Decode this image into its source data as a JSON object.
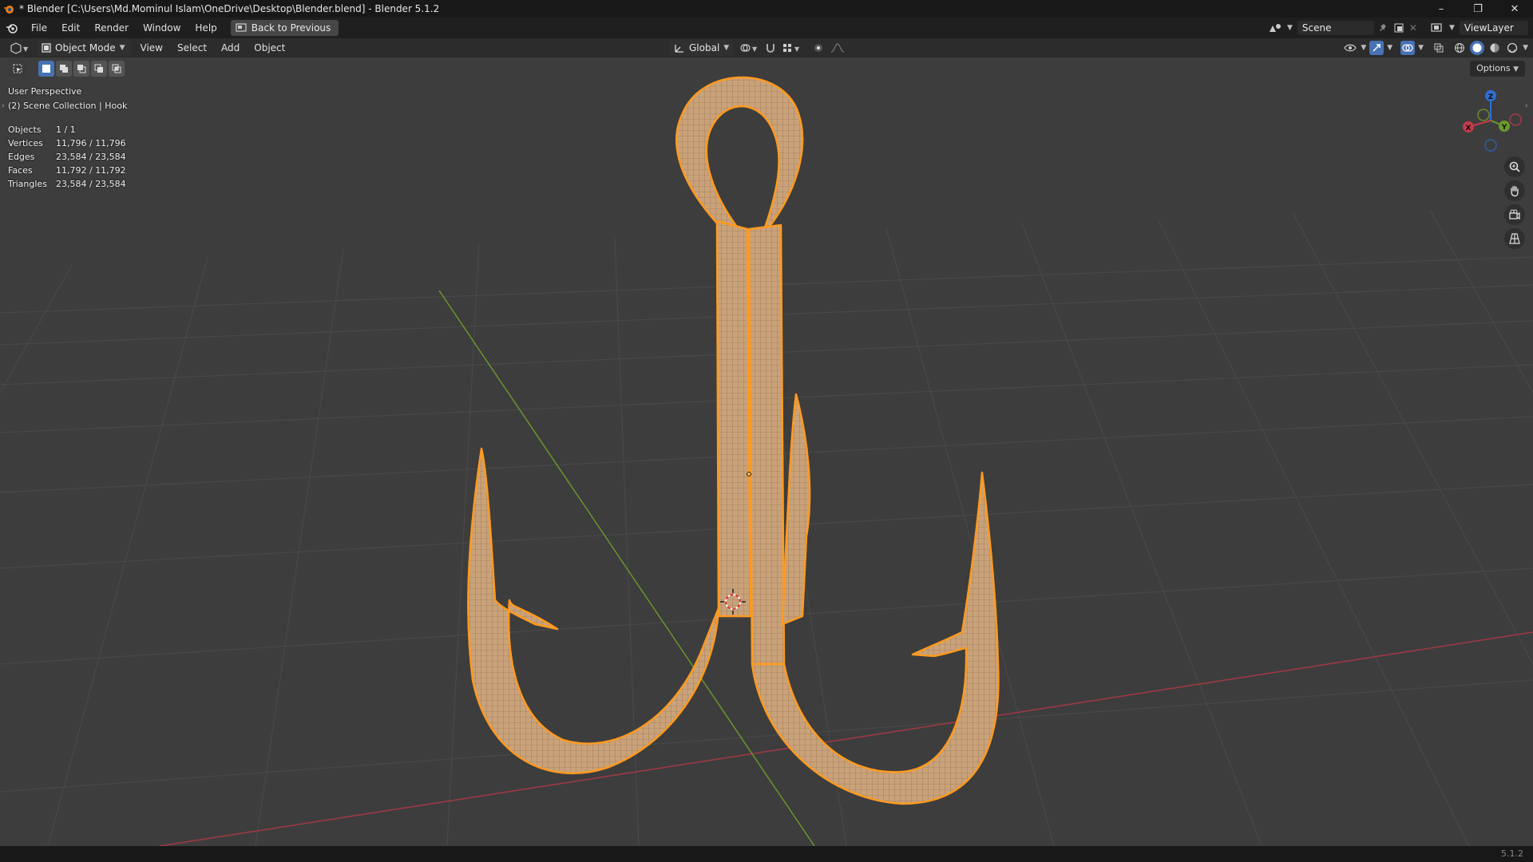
{
  "window": {
    "title": "* Blender [C:\\Users\\Md.Mominul Islam\\OneDrive\\Desktop\\Blender.blend] - Blender 5.1.2",
    "minimize_glyph": "–",
    "maximize_glyph": "❐",
    "close_glyph": "✕"
  },
  "menubar": {
    "items": [
      "File",
      "Edit",
      "Render",
      "Window",
      "Help"
    ],
    "back_button": "Back to Previous",
    "scene_label": "Scene",
    "viewlayer_label": "ViewLayer"
  },
  "header": {
    "mode": "Object Mode",
    "menus": [
      "View",
      "Select",
      "Add",
      "Object"
    ],
    "transform_orientation": "Global"
  },
  "viewport": {
    "perspective": "User Perspective",
    "collection": "(2) Scene Collection | Hook",
    "options_label": "Options",
    "gizmo_labels": {
      "x": "X",
      "y": "Y",
      "z": "Z"
    }
  },
  "stats": [
    {
      "label": "Objects",
      "value": "1 / 1"
    },
    {
      "label": "Vertices",
      "value": "11,796 / 11,796"
    },
    {
      "label": "Edges",
      "value": "23,584 / 23,584"
    },
    {
      "label": "Faces",
      "value": "11,792 / 11,792"
    },
    {
      "label": "Triangles",
      "value": "23,584 / 23,584"
    }
  ],
  "statusbar": {
    "version": "5.1.2"
  },
  "colors": {
    "selection_outline": "#ff9a1f",
    "mesh_surface": "#c9a27a",
    "x_axis": "#9c3a44",
    "y_axis": "#6b9a2b",
    "active_tool": "#4772b3"
  }
}
